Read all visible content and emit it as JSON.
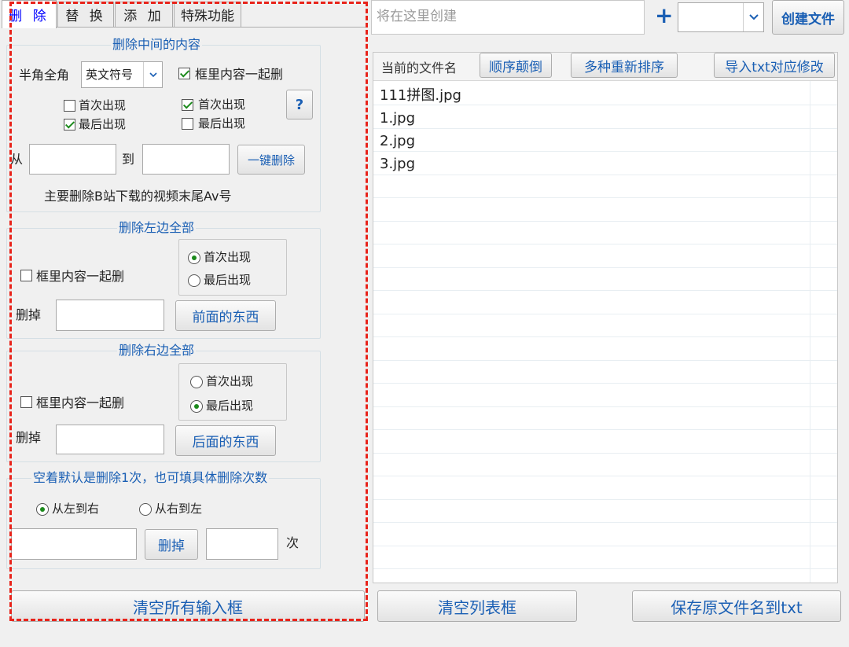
{
  "tabs": {
    "delete": "删 除",
    "replace": "替 换",
    "add": "添 加",
    "special": "特殊功能"
  },
  "top": {
    "filename_placeholder": "将在这里创建",
    "plus": "+",
    "create_file": "创建文件",
    "dropdown_value": ""
  },
  "middle_group": {
    "title": "删除中间的内容",
    "halfwidth_label": "半角全角",
    "symbol_select": "英文符号",
    "with_box_label": "框里内容一起删",
    "left_first": "首次出现",
    "left_last": "最后出现",
    "right_first": "首次出现",
    "right_last": "最后出现",
    "help": "?",
    "from_label": "从",
    "to_label": "到",
    "from_value": "",
    "to_value": "",
    "one_click_delete": "一键删除",
    "note": "主要删除B站下载的视频末尾Av号"
  },
  "left_group": {
    "title": "删除左边全部",
    "with_box_label": "框里内容一起删",
    "first": "首次出现",
    "last": "最后出现",
    "delete_label": "删掉",
    "value": "",
    "button": "前面的东西"
  },
  "right_group": {
    "title": "删除右边全部",
    "with_box_label": "框里内容一起删",
    "first": "首次出现",
    "last": "最后出现",
    "delete_label": "删掉",
    "value": "",
    "button": "后面的东西"
  },
  "count_group": {
    "title": "空着默认是删除1次，也可填具体删除次数",
    "ltr": "从左到右",
    "rtl": "从右到左",
    "text_value": "",
    "delete_button": "删掉",
    "count_value": "",
    "times_label": "次"
  },
  "list": {
    "header": "当前的文件名",
    "reverse": "顺序颠倒",
    "resort": "多种重新排序",
    "import_txt": "导入txt对应修改",
    "files": [
      "111拼图.jpg",
      "1.jpg",
      "2.jpg",
      "3.jpg"
    ]
  },
  "bottom": {
    "clear_inputs": "清空所有输入框",
    "clear_list": "清空列表框",
    "save_names": "保存原文件名到txt"
  },
  "colors": {
    "accent": "#1a5fb4",
    "highlight": "#e8231a",
    "check": "#1c8a1c"
  }
}
